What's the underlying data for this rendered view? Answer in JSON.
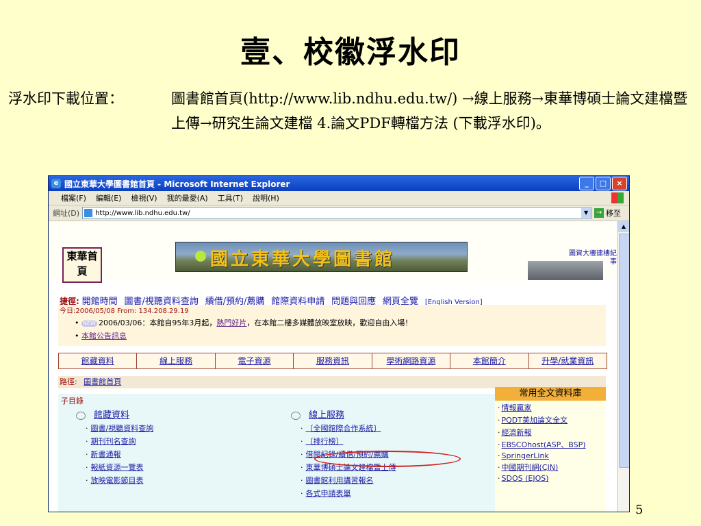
{
  "slide": {
    "title": "壹、校徽浮水印",
    "intro_label": "浮水印下載位置：",
    "intro_body": "圖書館首頁(http://www.lib.ndhu.edu.tw/) →線上服務→東華博碩士論文建檔暨上傳→研究生論文建檔 4.論文PDF轉檔方法 (下載浮水印)。",
    "page_number": "5"
  },
  "browser": {
    "window_title": "國立東華大學圖書館首頁 - Microsoft Internet Explorer",
    "menu": [
      "檔案(F)",
      "編輯(E)",
      "檢視(V)",
      "我的最愛(A)",
      "工具(T)",
      "說明(H)"
    ],
    "address_label": "網址(D)",
    "url": "http://www.lib.ndhu.edu.tw/",
    "go_label": "移至"
  },
  "page": {
    "home_logo": "東華首頁",
    "banner_text": "國立東華大學圖書館",
    "building_link": "圖資大樓建樓紀事",
    "quick_label": "捷徑:",
    "quick_links": [
      "開館時間",
      "圖書/視聽資料查詢",
      "續借/預約/薦購",
      "館際資料申請",
      "問題與回應",
      "網頁全覽",
      "[English Version]"
    ],
    "today_line": "今日:2006/05/08  From: 134.208.29.19",
    "new_badge": "NEW",
    "news_item_text_a": "2006/03/06：本館自95年3月起，",
    "news_item_link": "熱門好片",
    "news_item_text_b": "，在本館二樓多媒體放映室放映，歡迎自由入場！",
    "news_item_2": "本館公告訊息",
    "tabs": [
      "館藏資料",
      "線上服務",
      "電子資源",
      "服務資訊",
      "學術網路資源",
      "本館簡介",
      "升學/就業資訊"
    ],
    "path_label": "路徑:",
    "path_value": "圖書館首頁",
    "sub_label": "子目錄",
    "col1_head": "館藏資料",
    "col1_items": [
      "圖書/視聽資料查詢",
      "期刊刊名查詢",
      "新書通報",
      "報紙資源一覽表",
      "放映電影節目表"
    ],
    "col2_head": "線上服務",
    "col2_items": [
      "〔全國館際合作系統〕",
      "〔排行榜〕",
      "借閱紀錄/續借/預約/薦購",
      "東華博碩士論文建檔暨上傳",
      "圖書館利用講習報名",
      "各式申請表單"
    ],
    "db_title": "常用全文資料庫",
    "db_items": [
      "情報贏家",
      "PQDT美加論文全文",
      "經濟新報",
      "EBSCOhost(ASP、BSP)",
      "SpringerLink",
      "中國期刊網(CJN)",
      "SDOS (EJOS)"
    ]
  }
}
